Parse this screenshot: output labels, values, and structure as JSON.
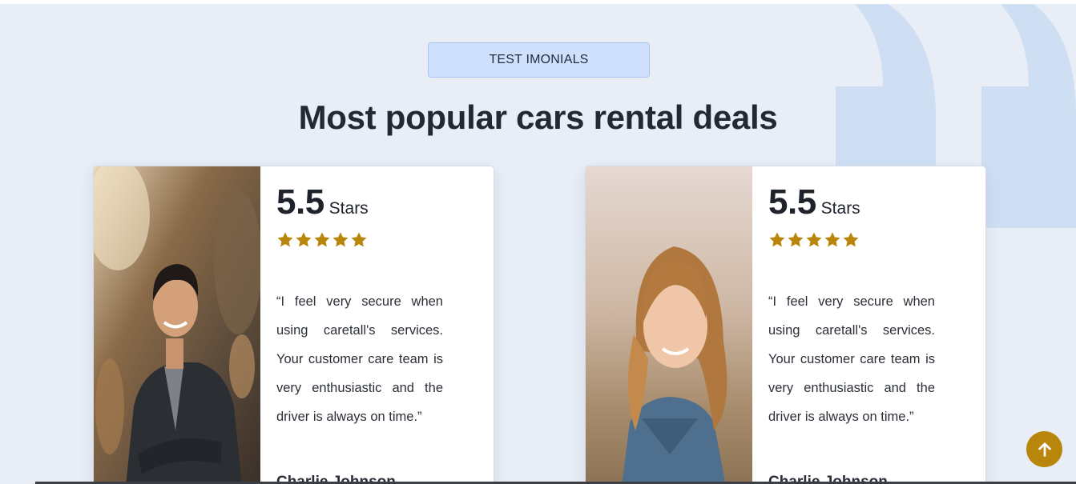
{
  "section": {
    "badge_label": "TEST IMONIALS",
    "heading": "Most popular cars rental deals"
  },
  "testimonials": [
    {
      "rating_value": "5.5",
      "rating_unit": "Stars",
      "stars": 5,
      "quote": "“I feel very secure when using caretall's services. Your customer care team is very enthusiastic and the driver is always on time.”",
      "author": "Charlie Johnson",
      "photo": "smiling-young-man-photo"
    },
    {
      "rating_value": "5.5",
      "rating_unit": "Stars",
      "stars": 5,
      "quote": "“I feel very secure when using caretall's services. Your customer care team is very enthusiastic and the driver is always on time.”",
      "author": "Charlie Johnson",
      "photo": "smiling-young-woman-photo"
    }
  ],
  "scroll_top": {
    "icon": "arrow-up-icon"
  },
  "colors": {
    "accent": "#b8860b",
    "badge_bg": "#cfe0fc",
    "section_bg": "#e8edf6",
    "heading": "#232833"
  }
}
